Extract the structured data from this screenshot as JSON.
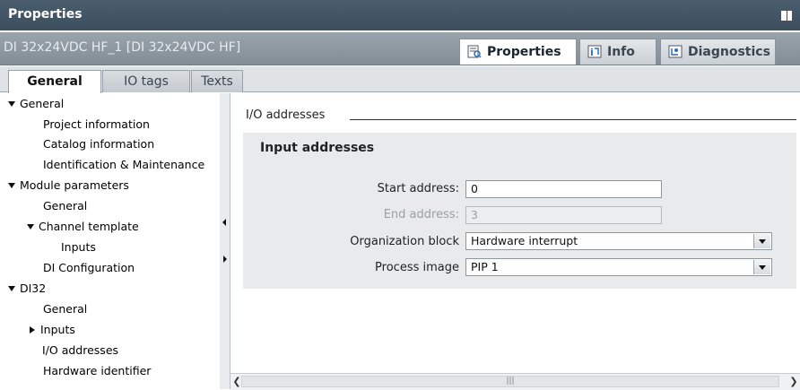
{
  "titlebar": {
    "title": "Properties",
    "pin_icon": "dock-icon"
  },
  "subbar": {
    "device_name": "DI 32x24VDC HF_1 [DI 32x24VDC HF]"
  },
  "right_tabs": [
    {
      "label": "Properties",
      "icon": "properties-icon",
      "active": true
    },
    {
      "label": "Info",
      "icon": "info-icon",
      "active": false
    },
    {
      "label": "Diagnostics",
      "icon": "diagnostics-icon",
      "active": false
    }
  ],
  "left_tabs": [
    {
      "label": "General",
      "active": true
    },
    {
      "label": "IO tags",
      "active": false
    },
    {
      "label": "Texts",
      "active": false
    }
  ],
  "nav": {
    "general": "General",
    "project_information": "Project information",
    "catalog_information": "Catalog information",
    "identification": "Identification & Maintenance",
    "module_parameters": "Module parameters",
    "mp_general": "General",
    "channel_template": "Channel template",
    "ct_inputs": "Inputs",
    "di_configuration": "DI Configuration",
    "di32": "DI32",
    "di32_general": "General",
    "di32_inputs": "Inputs",
    "io_addresses": "I/O addresses",
    "hardware_identifier": "Hardware identifier"
  },
  "content": {
    "section_title": "I/O addresses",
    "group_title": "Input addresses",
    "start_address_label": "Start address:",
    "start_address_value": "0",
    "end_address_label": "End address:",
    "end_address_value": "3",
    "ob_label": "Organization block",
    "ob_value": "Hardware interrupt",
    "pi_label": "Process image",
    "pi_value": "PIP 1"
  },
  "colors": {
    "titlebar": "#3d4f5e",
    "selection": "#3c79c4",
    "group_bg": "#e8eaec"
  }
}
